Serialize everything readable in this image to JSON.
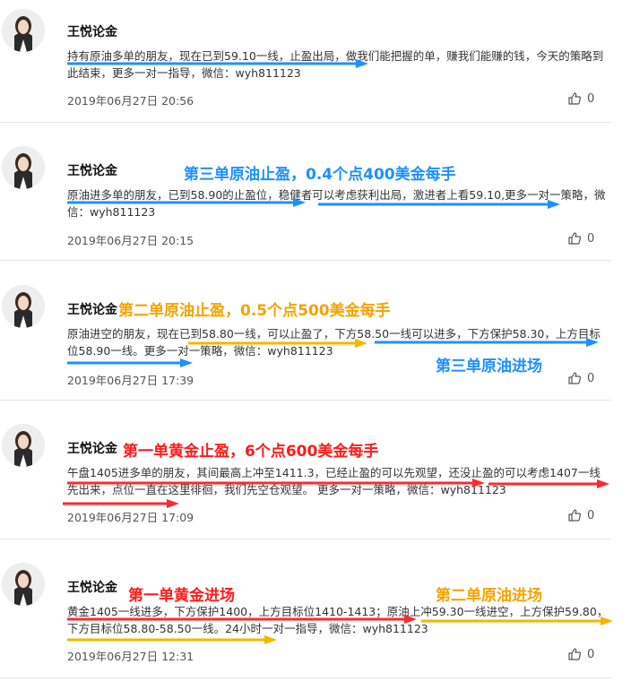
{
  "colors": {
    "blue": "#1e90ff",
    "orange": "#f7b500",
    "red": "#ff2a2a",
    "annotation_blue": "#1e90ff",
    "annotation_orange": "#f5a300",
    "annotation_red": "#ff1a1a"
  },
  "posts": [
    {
      "author": "王悦论金",
      "content": "持有原油多单的朋友，现在已到59.10一线，止盈出局，做我们能把握的单，赚我们能赚的钱，今天的策略到此结束，更多一对一指导，微信：wyh811123",
      "timestamp": "2019年06月27日 20:56",
      "likes": "0"
    },
    {
      "author": "王悦论金",
      "content": "原油进多单的朋友，已到58.90的止盈位，稳健者可以考虑获利出局，激进者上看59.10,更多一对一策略，微信：wyh811123",
      "timestamp": "2019年06月27日 20:15",
      "likes": "0",
      "annotation": "第三单原油止盈，0.4个点400美金每手"
    },
    {
      "author": "王悦论金",
      "content": "原油进空的朋友，现在已到58.80一线，可以止盈了，下方58.50一线可以进多，下方保护58.30，上方目标位58.90一线。更多一对一策略，微信：wyh811123",
      "timestamp": "2019年06月27日 17:39",
      "likes": "0",
      "annotation": "第二单原油止盈，0.5个点500美金每手",
      "annotation2": "第三单原油进场"
    },
    {
      "author": "王悦论金",
      "content": "午盘1405进多单的朋友，其间最高上冲至1411.3，已经止盈的可以先观望，还没止盈的可以考虑1407一线先出来，点位一直在这里徘徊，我们先空仓观望。 更多一对一策略，微信：wyh811123",
      "timestamp": "2019年06月27日 17:09",
      "likes": "0",
      "annotation": "第一单黄金止盈，6个点600美金每手"
    },
    {
      "author": "王悦论金",
      "content": "黄金1405一线进多，下方保护1400，上方目标位1410-1413；原油上冲59.30一线进空，上方保护59.80，下方目标位58.80-58.50一线。24小时一对一指导，微信：wyh811123",
      "timestamp": "2019年06月27日 12:31",
      "likes": "0",
      "annotation": "第一单黄金进场",
      "annotation2": "第二单原油进场"
    }
  ]
}
